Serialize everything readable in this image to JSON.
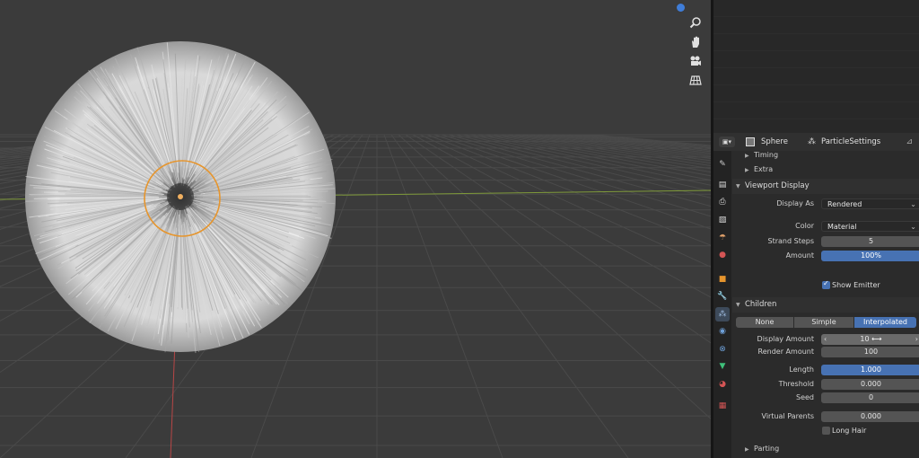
{
  "colors": {
    "accent": "#4772b3",
    "selection_orange": "#e6952d",
    "x_axis": "#c94a4a",
    "y_axis": "#8fa83a"
  },
  "viewport": {
    "gizmo_buttons": [
      {
        "icon": "zoom-icon"
      },
      {
        "icon": "hand-pan-icon"
      },
      {
        "icon": "camera-icon"
      },
      {
        "icon": "grid-ortho-icon"
      }
    ]
  },
  "properties": {
    "header": {
      "object_name": "Sphere",
      "settings_name": "ParticleSettings"
    },
    "tabs": [
      "tool-icon",
      "render-icon",
      "output-icon",
      "view-layer-icon",
      "scene-icon",
      "world-icon",
      "object-icon",
      "modifier-icon",
      "particles-icon",
      "physics-icon",
      "constraints-icon",
      "data-icon",
      "material-icon",
      "texture-icon"
    ],
    "timing_label": "Timing",
    "extra_label": "Extra",
    "viewport_display": {
      "title": "Viewport Display",
      "display_as_label": "Display As",
      "display_as_value": "Rendered",
      "color_label": "Color",
      "color_value": "Material",
      "strand_steps_label": "Strand Steps",
      "strand_steps_value": "5",
      "amount_label": "Amount",
      "amount_value": "100%",
      "show_emitter_label": "Show Emitter"
    },
    "children": {
      "title": "Children",
      "modes": [
        "None",
        "Simple",
        "Interpolated"
      ],
      "display_amount_label": "Display Amount",
      "display_amount_value": "10",
      "render_amount_label": "Render Amount",
      "render_amount_value": "100",
      "length_label": "Length",
      "length_value": "1.000",
      "threshold_label": "Threshold",
      "threshold_value": "0.000",
      "seed_label": "Seed",
      "seed_value": "0",
      "virtual_parents_label": "Virtual Parents",
      "virtual_parents_value": "0.000",
      "long_hair_label": "Long Hair"
    },
    "parting_label": "Parting"
  }
}
